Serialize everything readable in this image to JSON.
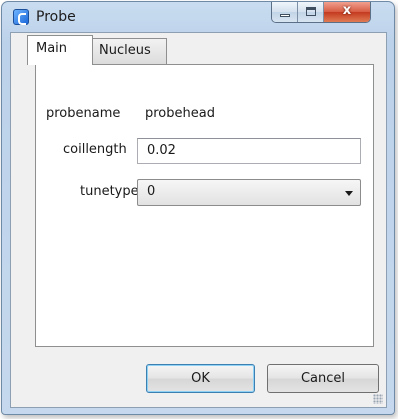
{
  "window": {
    "title": "Probe",
    "icon": "app-icon",
    "controls": {
      "close": "x"
    }
  },
  "tabs": [
    {
      "label": "Main",
      "active": true
    },
    {
      "label": "Nucleus",
      "active": false
    }
  ],
  "form": {
    "probename": {
      "label": "probename",
      "value": "probehead"
    },
    "coillength": {
      "label": "coillength",
      "value": "0.02"
    },
    "tunetype": {
      "label": "tunetype",
      "value": "0"
    }
  },
  "buttons": {
    "ok": "OK",
    "cancel": "Cancel"
  },
  "colors": {
    "frame": "#c5d8ed",
    "close_button": "#d75b42",
    "dialog_bg": "#f0f0f0",
    "default_button_border": "#3c7fb1"
  }
}
